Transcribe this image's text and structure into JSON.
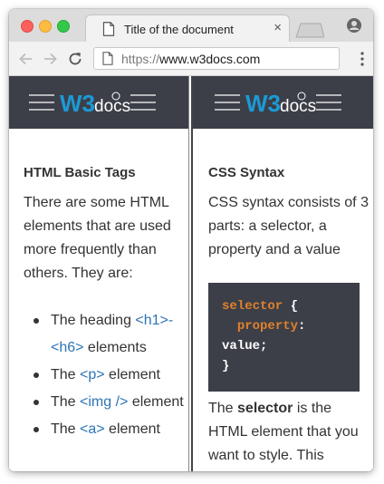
{
  "browser": {
    "tab_title": "Title of the document",
    "tab_close": "×",
    "url_scheme": "https://",
    "url_host": "www.w3docs.com"
  },
  "logo": {
    "w3": "W3",
    "docs": "docs",
    "colors": {
      "w": "#1b9ad6",
      "three": "#8cc63f",
      "docs": "#ffffff",
      "header_bg": "#3c3f48"
    }
  },
  "left_pane": {
    "heading": "HTML Basic Tags",
    "intro": "There are some HTML elements that are used more frequently than others. They are:",
    "list": [
      {
        "prefix": "The heading ",
        "code": "<h1>-<h6>",
        "suffix": " elements"
      },
      {
        "prefix": "The ",
        "code": "<p>",
        "suffix": " element"
      },
      {
        "prefix": "The ",
        "code": "<img />",
        "suffix": " element"
      },
      {
        "prefix": "The ",
        "code": "<a>",
        "suffix": " element"
      }
    ]
  },
  "right_pane": {
    "heading": "CSS Syntax",
    "intro": "CSS syntax consists of 3 parts: a selector, a property and a value",
    "code": {
      "selector": "selector",
      "open_brace": " {",
      "property": "property",
      "colon": ":",
      "value": "value;",
      "close_brace": "}"
    },
    "para2_start": "The ",
    "para2_bold": "selector",
    "para2_rest": " is the HTML element that you want to style. This"
  },
  "colors": {
    "code_orange": "#e0802c",
    "tag_blue": "#2c74b5",
    "text": "#333333"
  }
}
